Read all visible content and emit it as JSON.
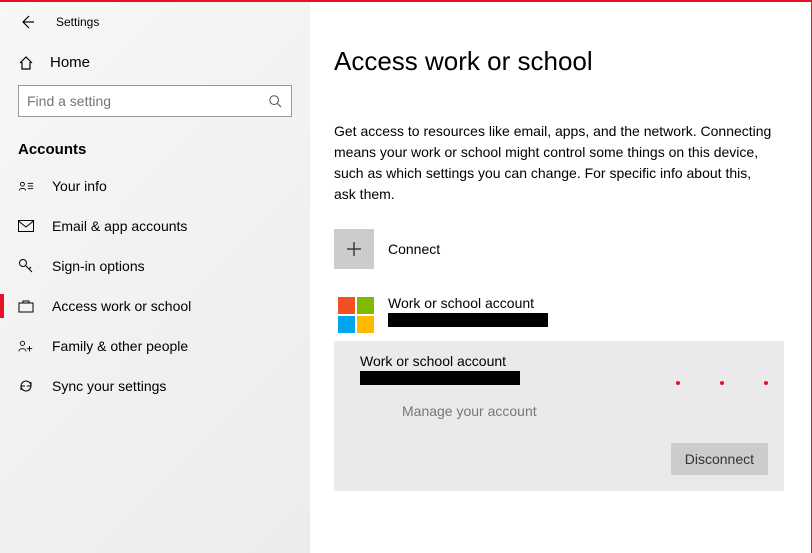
{
  "window": {
    "title": "Settings"
  },
  "home_label": "Home",
  "search": {
    "placeholder": "Find a setting"
  },
  "section_title": "Accounts",
  "nav": {
    "your_info": "Your info",
    "email_accounts": "Email & app accounts",
    "signin_options": "Sign-in options",
    "access_work": "Access work or school",
    "family": "Family & other people",
    "sync": "Sync your settings"
  },
  "page": {
    "heading": "Access work or school",
    "description": "Get access to resources like email, apps, and the network. Connecting means your work or school might control some things on this device, such as which settings you can change. For specific info about this, ask them.",
    "connect_label": "Connect",
    "account1_title": "Work or school account",
    "account2_title": "Work or school account",
    "manage_label": "Manage your account",
    "disconnect_label": "Disconnect"
  }
}
